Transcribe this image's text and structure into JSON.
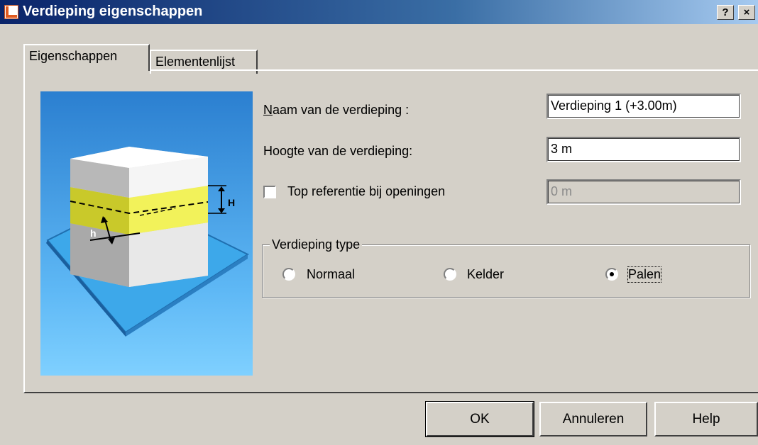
{
  "window": {
    "title": "Verdieping eigenschappen",
    "help_button": "?",
    "close_button": "×"
  },
  "tabs": [
    {
      "label": "Eigenschappen",
      "active": true
    },
    {
      "label": "Elementenlijst",
      "active": false
    }
  ],
  "illustration": {
    "label_H": "H",
    "label_h": "h"
  },
  "fields": {
    "name_label_first": "N",
    "name_label_rest": "aam van de verdieping :",
    "name_value": "Verdieping 1 (+3.00m)",
    "height_label": "Hoogte van de verdieping:",
    "height_value": "3 m",
    "top_ref_label": "Top referentie bij openingen",
    "top_ref_checked": false,
    "top_ref_value": "0 m"
  },
  "floor_type": {
    "group_label": "Verdieping type",
    "options": [
      {
        "label": "Normaal",
        "checked": false
      },
      {
        "label": "Kelder",
        "checked": false
      },
      {
        "label": "Palen",
        "checked": true
      }
    ]
  },
  "buttons": {
    "ok": "OK",
    "cancel": "Annuleren",
    "help": "Help"
  }
}
